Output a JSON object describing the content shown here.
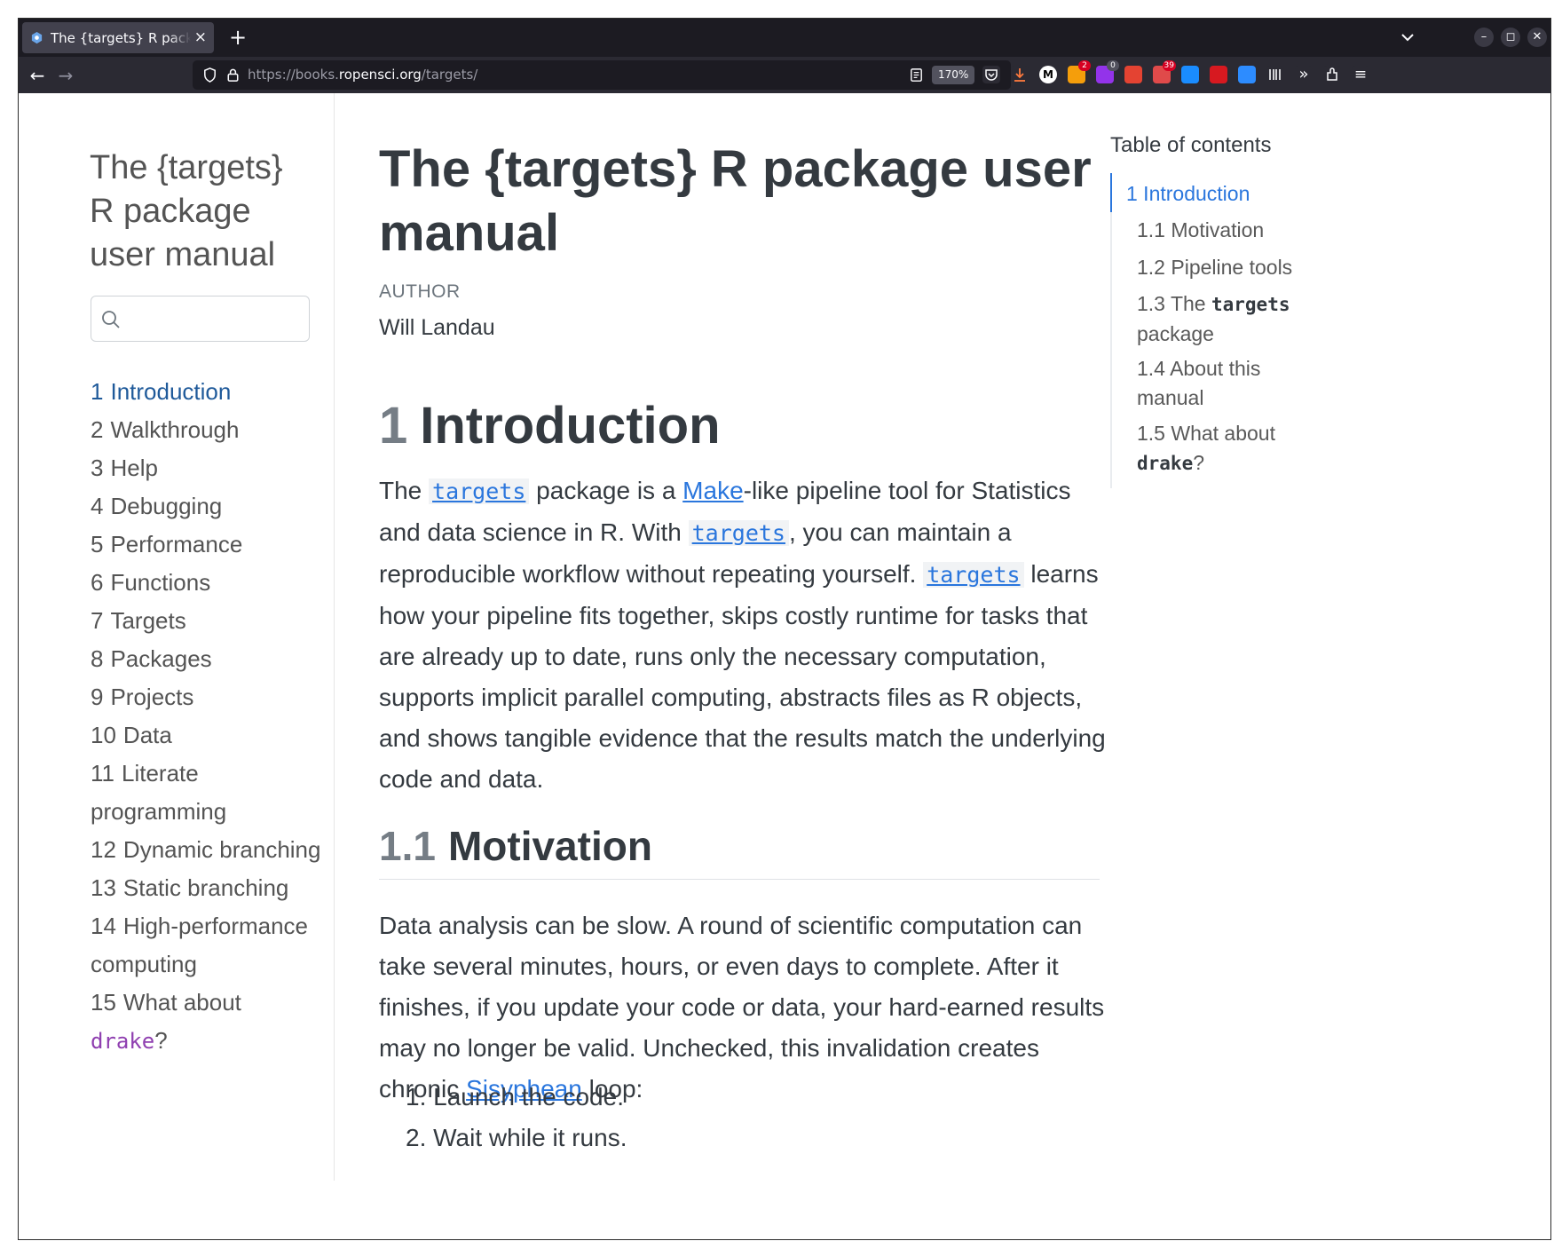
{
  "browser": {
    "tab_title": "The {targets} R package user manual",
    "tab_close": "×",
    "new_tab": "+",
    "url_scheme": "https://books.",
    "url_host": "ropensci.org",
    "url_path": "/targets/",
    "zoom": "170%",
    "back": "←",
    "forward": "→",
    "extensions": [
      {
        "icon": "pocket-icon",
        "color": "#2b2a33"
      },
      {
        "icon": "download-icon",
        "color": "#2b2a33"
      },
      {
        "icon": "medium-icon",
        "color": "#ffffff"
      },
      {
        "icon": "rss-icon",
        "color": "#f59e0b",
        "badge": "2",
        "badge_color": "#d70022"
      },
      {
        "icon": "extension-purple-icon",
        "color": "#9333ea",
        "badge": "0",
        "badge_color": "#52525e"
      },
      {
        "icon": "todoist-icon",
        "color": "#e44332"
      },
      {
        "icon": "mail-icon",
        "color": "#e04a4a",
        "badge": "39",
        "badge_color": "#d70022"
      },
      {
        "icon": "onepassword-icon",
        "color": "#1a8cff"
      },
      {
        "icon": "pdf-icon",
        "color": "#d71920"
      },
      {
        "icon": "zoom-icon",
        "color": "#2d8cff"
      },
      {
        "icon": "barcode-icon",
        "color": "#2b2a33"
      },
      {
        "icon": "overflow-icon",
        "color": "#2b2a33"
      },
      {
        "icon": "extensions-icon",
        "color": "#2b2a33"
      },
      {
        "icon": "menu-icon",
        "color": "#2b2a33"
      }
    ]
  },
  "sidebar": {
    "book_title": "The {targets} R package user manual",
    "search_placeholder": "",
    "items": [
      {
        "num": "1",
        "label": "Introduction",
        "active": true
      },
      {
        "num": "2",
        "label": "Walkthrough"
      },
      {
        "num": "3",
        "label": "Help"
      },
      {
        "num": "4",
        "label": "Debugging"
      },
      {
        "num": "5",
        "label": "Performance"
      },
      {
        "num": "6",
        "label": "Functions"
      },
      {
        "num": "7",
        "label": "Targets"
      },
      {
        "num": "8",
        "label": "Packages"
      },
      {
        "num": "9",
        "label": "Projects"
      },
      {
        "num": "10",
        "label": "Data"
      },
      {
        "num": "11",
        "label": "Literate programming"
      },
      {
        "num": "12",
        "label": "Dynamic branching"
      },
      {
        "num": "13",
        "label": "Static branching"
      },
      {
        "num": "14",
        "label": "High-performance computing"
      },
      {
        "num": "15",
        "label": "What about",
        "code": "drake",
        "suffix": "?"
      }
    ]
  },
  "main": {
    "title": "The {targets} R package user manual",
    "author_label": "AUTHOR",
    "author_name": "Will Landau",
    "intro": {
      "num": "1",
      "heading": "Introduction",
      "p_the": "The",
      "p_targets": "targets",
      "p_a": "package is a",
      "p_make": "Make",
      "p_b": "-like pipeline tool for Statistics and data science in R. With",
      "p_c": ", you can maintain a reproducible workflow without repeating yourself.",
      "p_d": "learns how your pipeline fits together, skips costly runtime for tasks that are already up to date, runs only the necessary computation, supports implicit parallel computing, abstracts files as R objects, and shows tangible evidence that the results match the underlying code and data."
    },
    "motivation": {
      "num": "1.1",
      "heading": "Motivation",
      "p_a": "Data analysis can be slow. A round of scientific computation can take several minutes, hours, or even days to complete. After it finishes, if you update your code or data, your hard-earned results may no longer be valid. Unchecked, this invalidation creates chronic",
      "p_link": "Sisyphean",
      "p_b": "loop:",
      "steps": [
        "1. Launch the code.",
        "2. Wait while it runs."
      ]
    }
  },
  "toc": {
    "title": "Table of contents",
    "items": [
      {
        "label": "1 Introduction",
        "active": true
      },
      {
        "label": "1.1 Motivation"
      },
      {
        "label": "1.2 Pipeline tools"
      },
      {
        "label_a": "1.3 The",
        "code": "targets",
        "label_b": "package"
      },
      {
        "label": "1.4 About this manual"
      },
      {
        "label_a": "1.5 What about",
        "code": "drake",
        "label_b": "?"
      }
    ]
  }
}
